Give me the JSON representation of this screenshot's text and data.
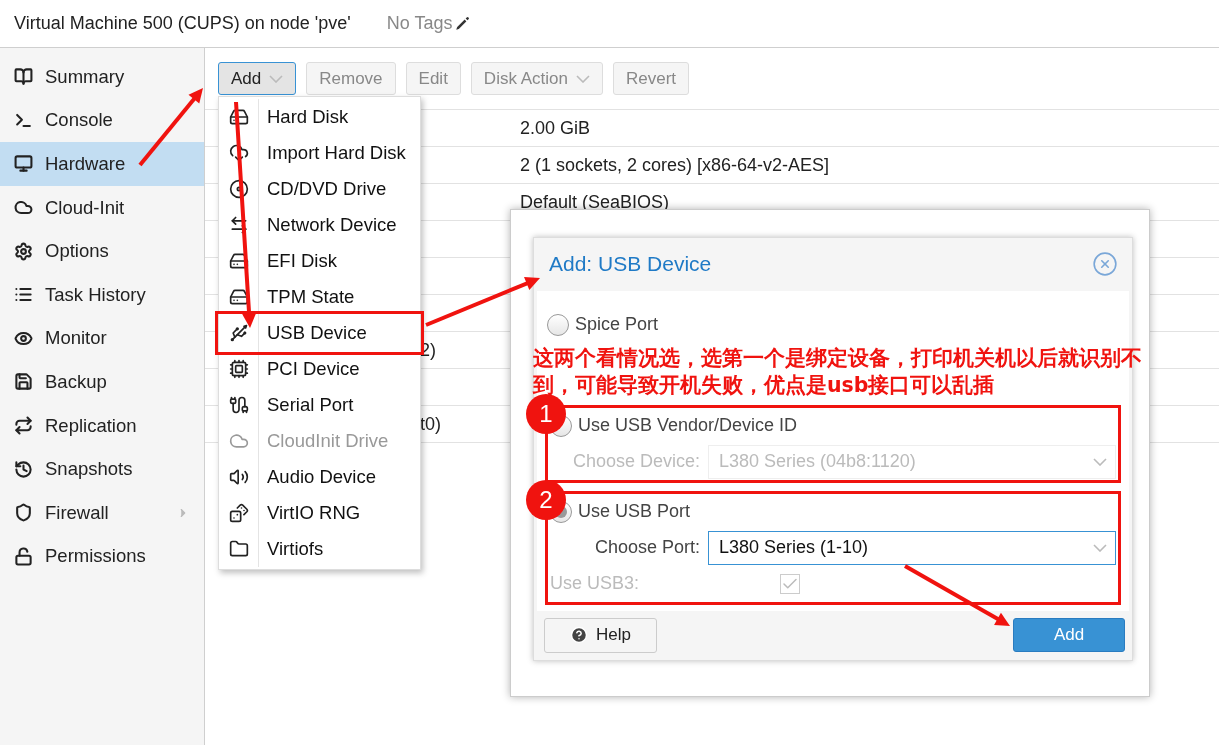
{
  "header": {
    "title": "Virtual Machine 500 (CUPS) on node 'pve'",
    "tags": "No Tags"
  },
  "sidebar": {
    "items": [
      {
        "label": "Summary",
        "selected": false,
        "expandable": false
      },
      {
        "label": "Console",
        "selected": false,
        "expandable": false
      },
      {
        "label": "Hardware",
        "selected": true,
        "expandable": false
      },
      {
        "label": "Cloud-Init",
        "selected": false,
        "expandable": false
      },
      {
        "label": "Options",
        "selected": false,
        "expandable": false
      },
      {
        "label": "Task History",
        "selected": false,
        "expandable": false
      },
      {
        "label": "Monitor",
        "selected": false,
        "expandable": false
      },
      {
        "label": "Backup",
        "selected": false,
        "expandable": false
      },
      {
        "label": "Replication",
        "selected": false,
        "expandable": false
      },
      {
        "label": "Snapshots",
        "selected": false,
        "expandable": false
      },
      {
        "label": "Firewall",
        "selected": false,
        "expandable": true
      },
      {
        "label": "Permissions",
        "selected": false,
        "expandable": false
      }
    ]
  },
  "toolbar": {
    "buttons": [
      {
        "label": "Add",
        "dropdown": true,
        "disabled": false
      },
      {
        "label": "Remove",
        "dropdown": false,
        "disabled": true
      },
      {
        "label": "Edit",
        "dropdown": false,
        "disabled": true
      },
      {
        "label": "Disk Action",
        "dropdown": true,
        "disabled": true
      },
      {
        "label": "Revert",
        "dropdown": false,
        "disabled": true
      }
    ]
  },
  "hardware_table": {
    "rows": [
      {
        "kind": "full",
        "value": "2.00 GiB"
      },
      {
        "kind": "full",
        "value": "2 (1 sockets, 2 cores) [x86-64-v2-AES]"
      },
      {
        "kind": "full",
        "value": "Default (SeaBIOS)"
      },
      {
        "kind": "hidden"
      },
      {
        "kind": "hidden"
      },
      {
        "kind": "hidden"
      },
      {
        "kind": "cut",
        "value": "2)"
      },
      {
        "kind": "hidden"
      },
      {
        "kind": "cut",
        "value": "t0)"
      },
      {
        "kind": "hidden"
      }
    ]
  },
  "add_menu": {
    "items": [
      {
        "label": "Hard Disk",
        "disabled": false,
        "highlighted": false
      },
      {
        "label": "Import Hard Disk",
        "disabled": false,
        "highlighted": false
      },
      {
        "label": "CD/DVD Drive",
        "disabled": false,
        "highlighted": false
      },
      {
        "label": "Network Device",
        "disabled": false,
        "highlighted": false
      },
      {
        "label": "EFI Disk",
        "disabled": false,
        "highlighted": false
      },
      {
        "label": "TPM State",
        "disabled": false,
        "highlighted": false
      },
      {
        "label": "USB Device",
        "disabled": false,
        "highlighted": true
      },
      {
        "label": "PCI Device",
        "disabled": false,
        "highlighted": false
      },
      {
        "label": "Serial Port",
        "disabled": false,
        "highlighted": false
      },
      {
        "label": "CloudInit Drive",
        "disabled": true,
        "highlighted": false
      },
      {
        "label": "Audio Device",
        "disabled": false,
        "highlighted": false
      },
      {
        "label": "VirtIO RNG",
        "disabled": false,
        "highlighted": false
      },
      {
        "label": "Virtiofs",
        "disabled": false,
        "highlighted": false
      }
    ]
  },
  "dialog": {
    "title": "Add: USB Device",
    "note": "这两个看情况选，选第一个是绑定设备，打印机关机以后就识别不到，可能导致开机失败，优点是usb接口可以乱插",
    "sections": [
      {
        "fields": [
          {
            "kind": "radio",
            "label": "Spice Port",
            "selected": false
          }
        ]
      },
      {
        "marker": "1",
        "fields": [
          {
            "kind": "radio",
            "label": "Use USB Vendor/Device ID",
            "selected": false
          },
          {
            "kind": "combo",
            "label": "Choose Device:",
            "value": "L380 Series (04b8:1120)",
            "disabled": true
          }
        ]
      },
      {
        "marker": "2",
        "fields": [
          {
            "kind": "radio",
            "label": "Use USB Port",
            "selected": true
          },
          {
            "kind": "combo",
            "label": "Choose Port:",
            "value": "L380 Series (1-10)",
            "disabled": false
          },
          {
            "kind": "checkbox",
            "label": "Use USB3:",
            "checked": true,
            "disabled": true
          }
        ]
      }
    ],
    "help": "Help",
    "add": "Add"
  }
}
